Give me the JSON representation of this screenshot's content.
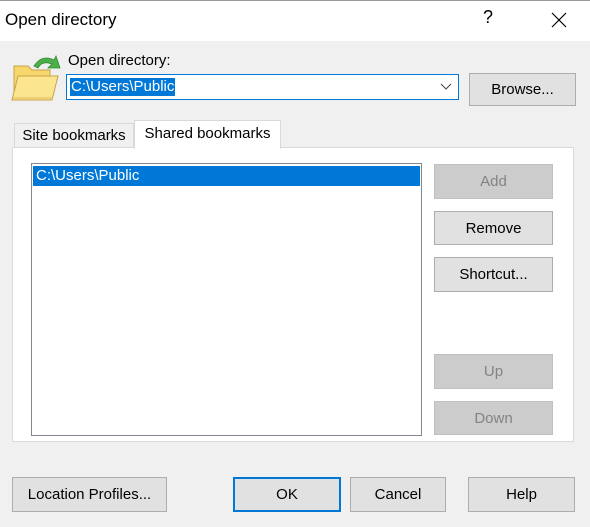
{
  "window": {
    "title": "Open directory",
    "help_label": "?",
    "close_icon": "close-icon"
  },
  "directory": {
    "icon": "open-folder-icon",
    "label": "Open directory:",
    "value": "C:\\Users\\Public",
    "browse_label": "Browse..."
  },
  "tabs": [
    {
      "label": "Site bookmarks",
      "active": false
    },
    {
      "label": "Shared bookmarks",
      "active": true
    }
  ],
  "bookmarks": {
    "items": [
      {
        "label": "C:\\Users\\Public",
        "selected": true
      }
    ],
    "buttons": {
      "add": {
        "label": "Add",
        "enabled": false
      },
      "remove": {
        "label": "Remove",
        "enabled": true
      },
      "shortcut": {
        "label": "Shortcut...",
        "enabled": true
      },
      "up": {
        "label": "Up",
        "enabled": false
      },
      "down": {
        "label": "Down",
        "enabled": false
      }
    }
  },
  "footer": {
    "location_profiles_label": "Location Profiles...",
    "ok_label": "OK",
    "cancel_label": "Cancel",
    "help_label": "Help"
  },
  "colors": {
    "accent": "#0078d7",
    "background": "#f0f0f0",
    "disabled_button": "#cccccc"
  }
}
